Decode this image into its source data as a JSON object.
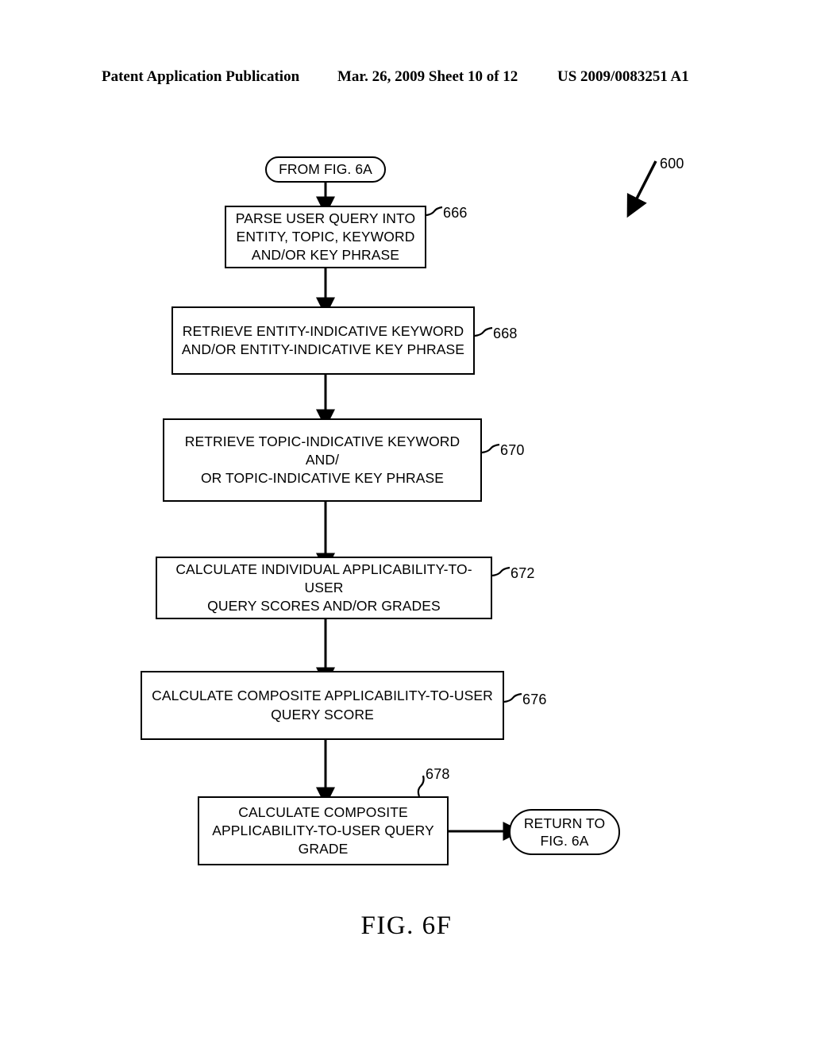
{
  "header": {
    "left": "Patent Application Publication",
    "middle": "Mar. 26, 2009  Sheet 10 of 12",
    "right": "US 2009/0083251 A1"
  },
  "figure": {
    "caption": "FIG. 6F",
    "diagram_reference": "600"
  },
  "flowchart": {
    "entry_terminator": "FROM FIG. 6A",
    "exit_terminator": "RETURN TO\nFIG. 6A",
    "exit_terminator_line1": "RETURN TO",
    "exit_terminator_line2": "FIG. 6A",
    "steps": [
      {
        "ref": "666",
        "text": "PARSE USER QUERY INTO ENTITY, TOPIC, KEYWORD AND/OR KEY PHRASE",
        "lines": [
          "PARSE USER QUERY INTO",
          "ENTITY, TOPIC, KEYWORD",
          "AND/OR KEY PHRASE"
        ]
      },
      {
        "ref": "668",
        "text": "RETRIEVE ENTITY-INDICATIVE KEYWORD AND/OR ENTITY-INDICATIVE KEY PHRASE",
        "lines": [
          "RETRIEVE ENTITY-INDICATIVE KEYWORD",
          "AND/OR ENTITY-INDICATIVE KEY PHRASE"
        ]
      },
      {
        "ref": "670",
        "text": "RETRIEVE TOPIC-INDICATIVE KEYWORD AND/ OR TOPIC-INDICATIVE KEY PHRASE",
        "lines": [
          "RETRIEVE TOPIC-INDICATIVE KEYWORD AND/",
          "OR TOPIC-INDICATIVE KEY PHRASE"
        ]
      },
      {
        "ref": "672",
        "text": "CALCULATE INDIVIDUAL APPLICABILITY-TO-USER QUERY SCORES AND/OR GRADES",
        "lines": [
          "CALCULATE INDIVIDUAL APPLICABILITY-TO-USER",
          "QUERY SCORES AND/OR GRADES"
        ]
      },
      {
        "ref": "676",
        "text": "CALCULATE COMPOSITE APPLICABILITY-TO-USER QUERY SCORE",
        "lines": [
          "CALCULATE COMPOSITE APPLICABILITY-TO-USER",
          "QUERY SCORE"
        ]
      },
      {
        "ref": "678",
        "text": "CALCULATE COMPOSITE APPLICABILITY-TO-USER QUERY GRADE",
        "lines": [
          "CALCULATE COMPOSITE",
          "APPLICABILITY-TO-USER QUERY",
          "GRADE"
        ]
      }
    ]
  },
  "colors": {
    "ink": "#000000",
    "paper": "#ffffff"
  }
}
